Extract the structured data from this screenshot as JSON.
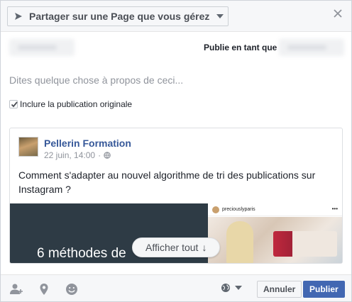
{
  "header": {
    "share_target_label": "Partager sur une Page que vous gérez"
  },
  "publish_as_label": "Publie en tant que",
  "composer": {
    "placeholder": "Dites quelque chose à propos de ceci..."
  },
  "include_original": {
    "label": "Inclure la publication originale",
    "checked": true
  },
  "shared_post": {
    "author": "Pellerin Formation",
    "timestamp": "22 juin, 14:00",
    "separator": "·",
    "text": "Comment s'adapter au nouvel algorithme de tri des publications sur Instagram ?",
    "media_headline": "6 méthodes de",
    "instagram_username": "preciouslyparis",
    "instagram_menu": "•••",
    "show_all_label": "Afficher tout",
    "show_all_arrow": "↓"
  },
  "footer": {
    "cancel_label": "Annuler",
    "publish_label": "Publier"
  },
  "colors": {
    "link_blue": "#365899",
    "publish_button": "#4267b2",
    "header_bg": "#f6f7f9"
  }
}
